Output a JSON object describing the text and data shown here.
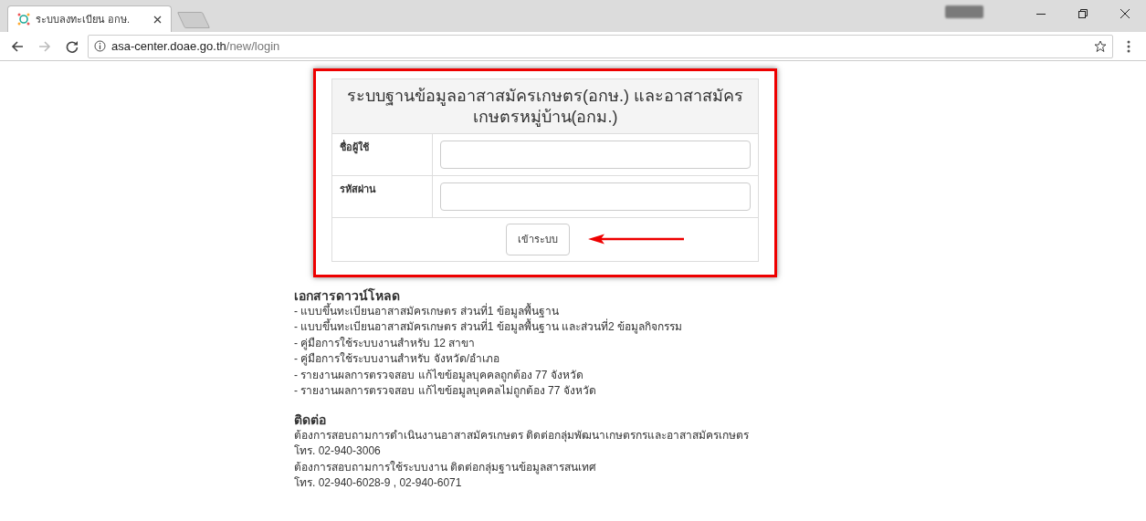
{
  "browser": {
    "tab_title": "ระบบลงทะเบียน อกษ.",
    "url_host": "asa-center.doae.go.th",
    "url_path": "/new/login"
  },
  "login": {
    "title": "ระบบฐานข้อมูลอาสาสมัครเกษตร(อกษ.) และอาสาสมัครเกษตรหมู่บ้าน(อกม.)",
    "fields": [
      {
        "label": "ชื่อผู้ใช้"
      },
      {
        "label": "รหัสผ่าน"
      }
    ],
    "button": "เข้าระบบ"
  },
  "downloads": {
    "heading": "เอกสารดาวน์โหลด",
    "items": [
      "- แบบขึ้นทะเบียนอาสาสมัครเกษตร ส่วนที่1 ข้อมูลพื้นฐาน",
      "- แบบขึ้นทะเบียนอาสาสมัครเกษตร ส่วนที่1 ข้อมูลพื้นฐาน และส่วนที่2 ข้อมูลกิจกรรม",
      "- คู่มือการใช้ระบบงานสำหรับ 12 สาขา",
      "- คู่มือการใช้ระบบงานสำหรับ จังหวัด/อำเภอ",
      "- รายงานผลการตรวจสอบ แก้ไขข้อมูลบุคคลถูกต้อง 77 จังหวัด",
      "- รายงานผลการตรวจสอบ แก้ไขข้อมูลบุคคลไม่ถูกต้อง 77 จังหวัด"
    ]
  },
  "contact": {
    "heading": "ติดต่อ",
    "lines": [
      "ต้องการสอบถามการดำเนินงานอาสาสมัครเกษตร ติดต่อกลุ่มพัฒนาเกษตรกรและอาสาสมัครเกษตร",
      "โทร. 02-940-3006",
      "ต้องการสอบถามการใช้ระบบงาน ติดต่อกลุ่มฐานข้อมูลสารสนเทศ",
      "โทร. 02-940-6028-9 , 02-940-6071"
    ]
  }
}
